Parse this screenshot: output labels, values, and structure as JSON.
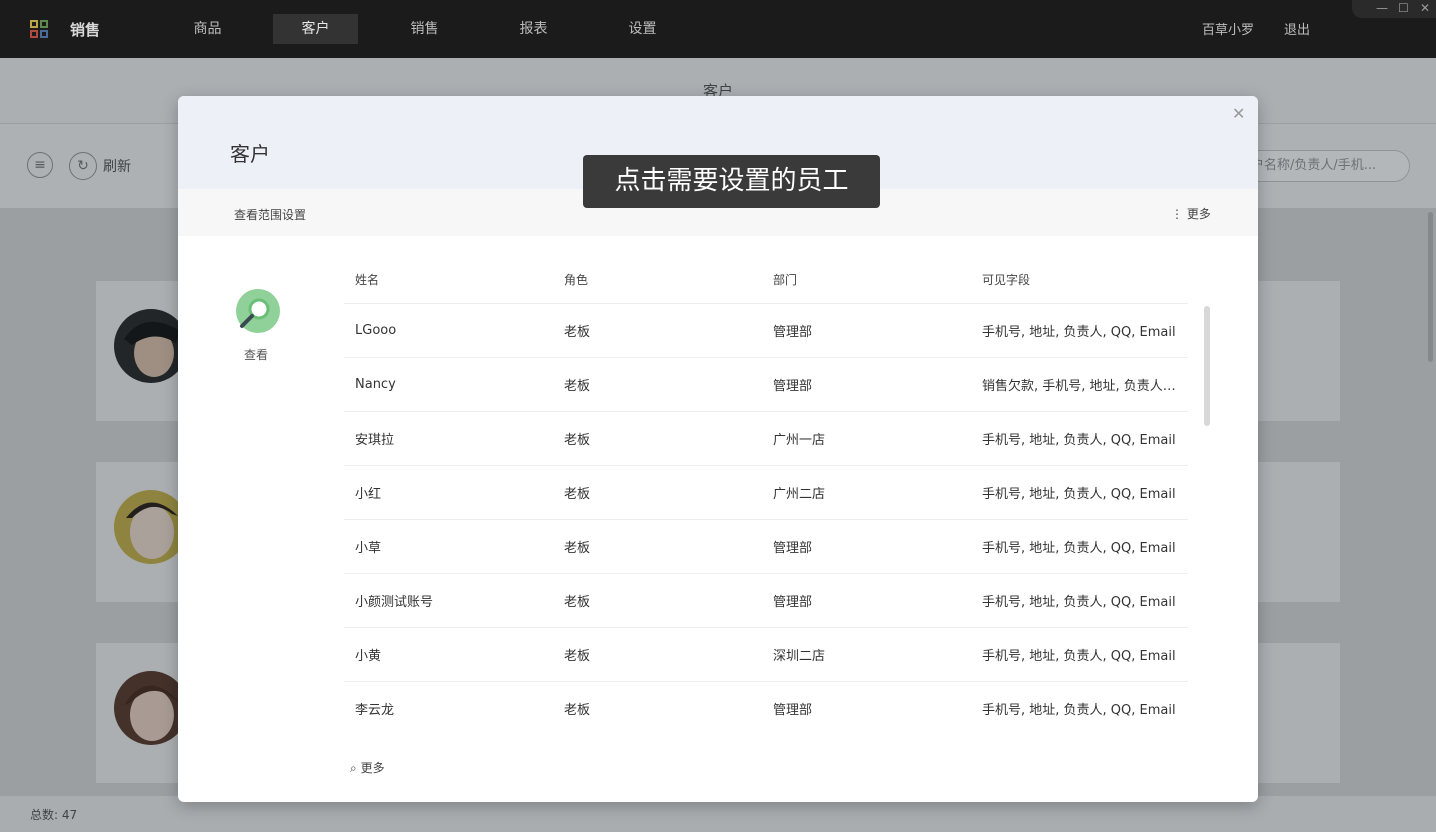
{
  "topbar": {
    "app_title": "销售",
    "nav": [
      "商品",
      "客户",
      "销售",
      "报表",
      "设置"
    ],
    "active_nav": "客户",
    "user": "百草小罗",
    "logout": "退出",
    "window_controls": [
      "minimize-icon",
      "maximize-icon",
      "close-icon"
    ]
  },
  "page": {
    "title": "客户",
    "refresh_label": "刷新",
    "search_placeholder": "户名称/负责人/手机...",
    "total_label": "总数:",
    "total_value": "47"
  },
  "dialog": {
    "title": "客户",
    "close_icon": "close-icon",
    "scope_label": "查看范围设置",
    "more_top": "更多",
    "view_label": "查看",
    "columns": [
      "姓名",
      "角色",
      "部门",
      "可见字段"
    ],
    "rows": [
      [
        "LGooo",
        "老板",
        "管理部",
        "手机号, 地址, 负责人, QQ, Email"
      ],
      [
        "Nancy",
        "老板",
        "管理部",
        "销售欠款, 手机号, 地址, 负责人, QQ"
      ],
      [
        "安琪拉",
        "老板",
        "广州一店",
        "手机号, 地址, 负责人, QQ, Email"
      ],
      [
        "小红",
        "老板",
        "广州二店",
        "手机号, 地址, 负责人, QQ, Email"
      ],
      [
        "小草",
        "老板",
        "管理部",
        "手机号, 地址, 负责人, QQ, Email"
      ],
      [
        "小颜测试账号",
        "老板",
        "管理部",
        "手机号, 地址, 负责人, QQ, Email"
      ],
      [
        "小黄",
        "老板",
        "深圳二店",
        "手机号, 地址, 负责人, QQ, Email"
      ],
      [
        "李云龙",
        "老板",
        "管理部",
        "手机号, 地址, 负责人, QQ, Email"
      ]
    ],
    "more_bottom": "更多"
  },
  "tooltip": "点击需要设置的员工",
  "colors": {
    "topbar": "#1b1b1b",
    "dialog_header": "#eef0f8",
    "view_icon": "#8fd198",
    "tooltip": "#3a3a3a"
  }
}
